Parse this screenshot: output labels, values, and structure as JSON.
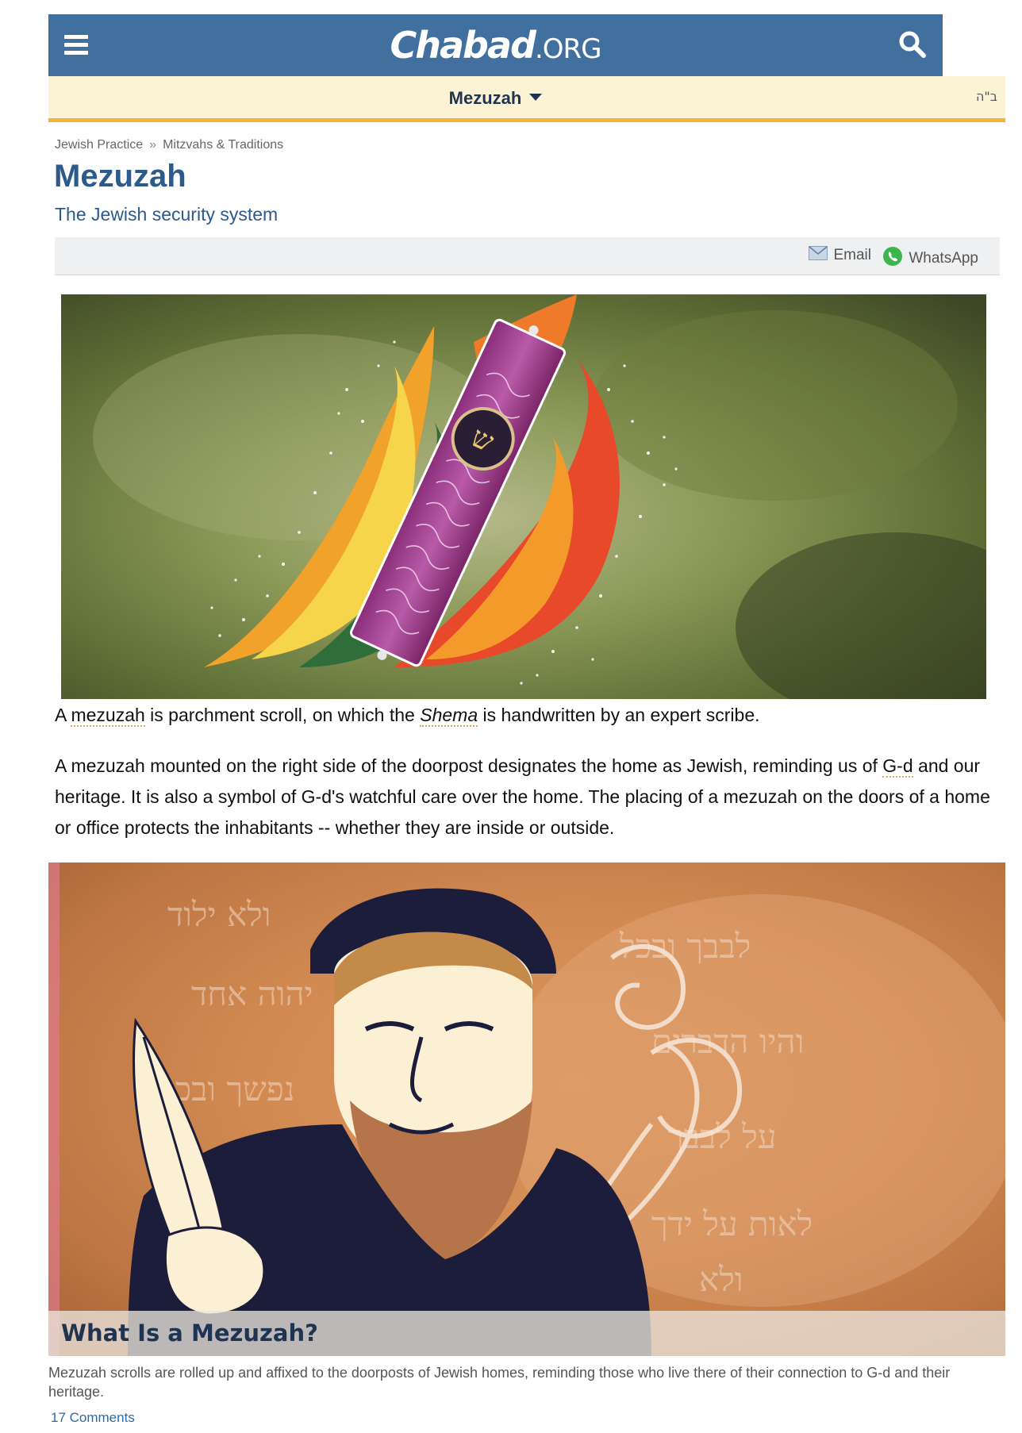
{
  "header": {
    "logo_brand": "Chabad",
    "logo_tld": ".ORG"
  },
  "subnav": {
    "title": "Mezuzah",
    "bsd": "ב\"ה"
  },
  "breadcrumb": {
    "items": [
      "Jewish Practice",
      "Mitzvahs & Traditions"
    ],
    "separator": "»"
  },
  "article": {
    "title": "Mezuzah",
    "subtitle": "The Jewish security system",
    "share": {
      "email_label": "Email",
      "whatsapp_label": "WhatsApp"
    },
    "caption": {
      "part1": "A ",
      "link_mezuzah": "mezuzah",
      "part2": " is parchment scroll, on which the ",
      "shema": "Shema",
      "part3": " is handwritten by an expert scribe."
    },
    "paragraph": {
      "part1": "A mezuzah mounted on the right side of the doorpost designates the home as Jewish, reminding us of ",
      "link_gd": "G-d",
      "part2": " and our heritage. It is also a symbol of G-d's watchful care over the home. The placing of a mezuzah on the doors of a home or office protects the inhabitants -- whether they are inside or outside."
    }
  },
  "feature_card": {
    "title": "What Is a Mezuzah?",
    "description": "Mezuzah scrolls are rolled up and affixed to the doorposts of Jewish homes, reminding those who live there of their connection to G-d and their heritage.",
    "comments": "17 Comments"
  },
  "icons": {
    "menu": "hamburger-menu-icon",
    "search": "search-icon",
    "email": "email-icon",
    "whatsapp": "whatsapp-icon"
  },
  "colors": {
    "header_blue": "#41709f",
    "subnav_bg": "#fcf3d4",
    "subnav_border": "#f2b43a",
    "title_blue": "#2c5a8a"
  }
}
